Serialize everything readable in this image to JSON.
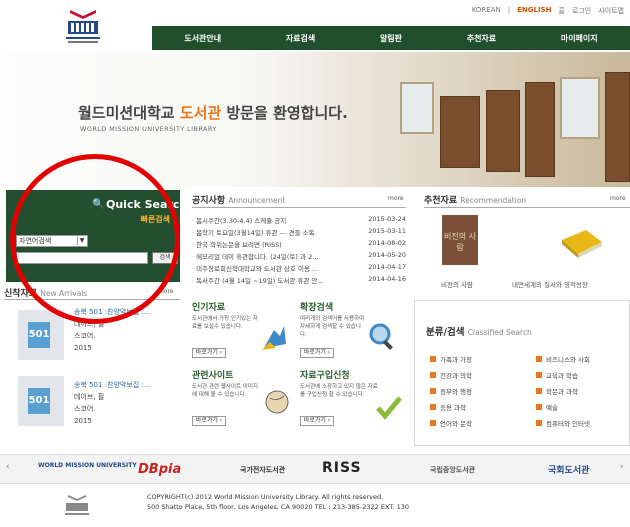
{
  "top_links": [
    "KOREAN",
    "ENGLISH",
    "홈",
    "로그인",
    "사이트맵"
  ],
  "nav": [
    "도서관안내",
    "자료검색",
    "알림판",
    "추천자료",
    "마이페이지"
  ],
  "hero": {
    "welcome_main": "월드미션대학교 ",
    "welcome_hl": "도서관",
    "welcome_tail": " 방문을 환영합니다.",
    "welcome_sub": "WORLD MISSION UNIVERSITY LIBRARY"
  },
  "logo": {
    "text": "WORLD MISSION UNIVERSITY"
  },
  "quick_search": {
    "title": "Quick Search",
    "title_ko": "빠른검색",
    "select_value": "자연어검색",
    "input_value": "",
    "button": "검색"
  },
  "notice": {
    "title": "공지사항",
    "title_en": "Announcement",
    "more": "more",
    "items": [
      {
        "title": "봄시주간(3.30-4.4) 스케쥴 공지",
        "date": "2015-03-24"
      },
      {
        "title": "봄학기 토요일(3월14일) 휴관 --- 견들 소독",
        "date": "2015-03-11"
      },
      {
        "title": "한국 학위논문을 보려면 (RISS)",
        "date": "2014-08-02"
      },
      {
        "title": "메모리얼 데이 휴관합니다. (24일(토) 과 2...",
        "date": "2014-05-20"
      },
      {
        "title": "미주장로회신학대학교와 도서관 상호 이용 ...",
        "date": "2014-04-17"
      },
      {
        "title": "독서주간 (4월 14일 ~19일) 도서관 휴관 안...",
        "date": "2014-04-16"
      }
    ]
  },
  "recommend": {
    "title": "추천자료",
    "title_en": "Recommendation",
    "more": "more",
    "items": [
      "비전의 사람",
      "내면세계의 질서와 영적성장"
    ],
    "book_title": "비전의 사람"
  },
  "new_arrivals": {
    "title": "신착자료",
    "title_en": "New Arrivals",
    "more": "more",
    "items": [
      {
        "cover": "501",
        "line1": "송북 501 :찬양악보집 :...",
        "line2": "데이브, 필",
        "line3": "스코어.",
        "line4": "2015"
      },
      {
        "cover": "501",
        "line1": "송북 501 :찬양악보집 :...",
        "line2": "데이브, 필",
        "line3": "스코어.",
        "line4": "2015"
      }
    ]
  },
  "services": [
    {
      "title": "인기자료",
      "desc": "도서관에서 가장 인기있는 자료를 보실수 있습니다.",
      "go": "바로가기 ›"
    },
    {
      "title": "확장검색",
      "desc": "여러개의 검색어를 사용하여 자세하게 검색할 수 있습니다.",
      "go": "바로가기 ›"
    },
    {
      "title": "관련사이트",
      "desc": "도서관 관련 웹사이트 이미지에 대해 볼 수 있습니다.",
      "go": "바로가기 ›"
    },
    {
      "title": "자료구입신청",
      "desc": "도서관에 소장하고 있지 않은 자료를 구입신청 할 수 있습니다.",
      "go": "바로가기 ›"
    }
  ],
  "classified": {
    "title": "분류/검색",
    "title_en": "Classified Search",
    "left": [
      "가족과 가정",
      "건강과 의학",
      "정부와 행정",
      "응용 과학",
      "언어와 문학"
    ],
    "right": [
      "비즈니스와 사회",
      "교육과 학습",
      "학문과 과학",
      "예술",
      "컴퓨터와 인터넷"
    ]
  },
  "partners": [
    "WORLD MISSION UNIVERSITY",
    "DBpia",
    "국가전자도서관",
    "RISS",
    "국립중앙도서관",
    "국회도서관"
  ],
  "footer": {
    "line1": "COPYRIGHT(c) 2012 World Mission University Library. All rights reserved.",
    "line2": "500 Shatto Place, 5th floor, Los Angeles, CA 90020   TEL : 213-385-2322 EXT. 130"
  },
  "colors": {
    "nav_bg": "#214e2c",
    "accent": "#e8771d",
    "annotation": "#e30000"
  }
}
